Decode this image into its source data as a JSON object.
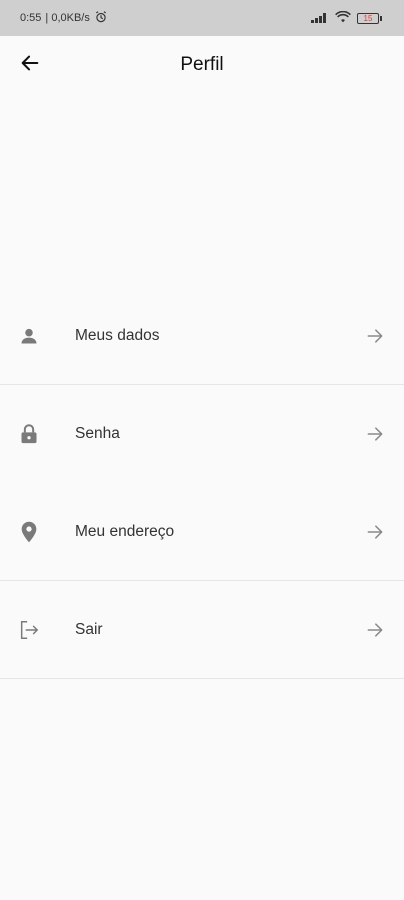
{
  "status_bar": {
    "time": "0:55",
    "network_speed": "| 0,0KB/s",
    "battery_level": "15"
  },
  "header": {
    "title": "Perfil"
  },
  "menu": {
    "items": [
      {
        "label": "Meus dados",
        "icon": "person-icon"
      },
      {
        "label": "Senha",
        "icon": "lock-icon"
      },
      {
        "label": "Meu endereço",
        "icon": "location-pin-icon"
      },
      {
        "label": "Sair",
        "icon": "logout-icon"
      }
    ]
  },
  "colors": {
    "background": "#fafafa",
    "status_bar": "#cfcfcf",
    "icon": "#7a7a7a",
    "divider": "#e6e6e6",
    "battery": "#e53935"
  }
}
